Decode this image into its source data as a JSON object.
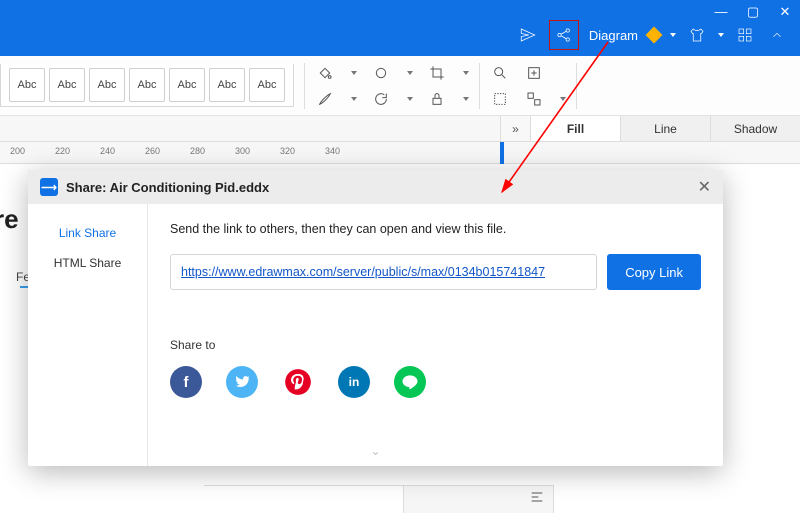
{
  "titlebar": {
    "diagram_label": "Diagram"
  },
  "toolbar": {
    "abc": [
      "Abc",
      "Abc",
      "Abc",
      "Abc",
      "Abc",
      "Abc",
      "Abc"
    ]
  },
  "ruler": {
    "ticks": [
      "200",
      "220",
      "240",
      "260",
      "280",
      "300",
      "320",
      "340"
    ]
  },
  "panels": {
    "fill": "Fill",
    "line": "Line",
    "shadow": "Shadow"
  },
  "canvas": {
    "frag1": "re",
    "frag2": "Fee"
  },
  "dialog": {
    "title": "Share: Air Conditioning Pid.eddx",
    "side": {
      "link": "Link Share",
      "html": "HTML Share"
    },
    "desc": "Send the link to others, then they can open and view this file.",
    "url": "https://www.edrawmax.com/server/public/s/max/0134b015741847",
    "copy": "Copy Link",
    "share_to": "Share to",
    "social": {
      "facebook": "f",
      "twitter": "t",
      "pinterest": "P",
      "linkedin": "in",
      "line": "LINE"
    }
  }
}
